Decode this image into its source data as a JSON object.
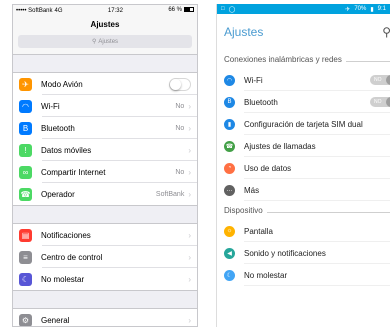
{
  "ios": {
    "status": {
      "carrier": "••••• SoftBank",
      "network": "4G",
      "time": "17:32",
      "battery": "66 %"
    },
    "title": "Ajustes",
    "search_placeholder": "Ajustes",
    "group1": [
      {
        "label": "Modo Avión",
        "value": "",
        "icon": "airplane-icon",
        "color": "#ff9500",
        "toggle": true
      },
      {
        "label": "Wi-Fi",
        "value": "No",
        "icon": "wifi-icon",
        "color": "#007aff"
      },
      {
        "label": "Bluetooth",
        "value": "No",
        "icon": "bluetooth-icon",
        "color": "#007aff"
      },
      {
        "label": "Datos móviles",
        "value": "",
        "icon": "antenna-icon",
        "color": "#4cd964"
      },
      {
        "label": "Compartir Internet",
        "value": "No",
        "icon": "hotspot-icon",
        "color": "#4cd964"
      },
      {
        "label": "Operador",
        "value": "SoftBank",
        "icon": "phone-icon",
        "color": "#4cd964"
      }
    ],
    "group2": [
      {
        "label": "Notificaciones",
        "value": "",
        "icon": "notifications-icon",
        "color": "#ff3b30"
      },
      {
        "label": "Centro de control",
        "value": "",
        "icon": "control-center-icon",
        "color": "#8e8e93"
      },
      {
        "label": "No molestar",
        "value": "",
        "icon": "moon-icon",
        "color": "#5856d6"
      }
    ],
    "group3": [
      {
        "label": "General",
        "value": "",
        "icon": "gear-icon",
        "color": "#8e8e93"
      }
    ]
  },
  "android": {
    "status": {
      "battery": "70%",
      "time": "9:1"
    },
    "title": "Ajustes",
    "section1": "Conexiones inalámbricas y redes",
    "section1_items": [
      {
        "label": "Wi-Fi",
        "toggle": "NO",
        "icon": "wifi-icon",
        "color": "#1e88e5"
      },
      {
        "label": "Bluetooth",
        "toggle": "NO",
        "icon": "bluetooth-icon",
        "color": "#1e88e5"
      },
      {
        "label": "Configuración de tarjeta SIM dual",
        "icon": "sim-card-icon",
        "color": "#1e88e5"
      },
      {
        "label": "Ajustes de llamadas",
        "icon": "phone-icon",
        "color": "#43a047"
      },
      {
        "label": "Uso de datos",
        "icon": "data-usage-icon",
        "color": "#ff7043"
      },
      {
        "label": "Más",
        "icon": "more-icon",
        "color": "#616161"
      }
    ],
    "section2": "Dispositivo",
    "section2_items": [
      {
        "label": "Pantalla",
        "icon": "display-icon",
        "color": "#ffb300"
      },
      {
        "label": "Sonido y notificaciones",
        "icon": "volume-icon",
        "color": "#26a69a"
      },
      {
        "label": "No molestar",
        "icon": "moon-icon",
        "color": "#42a5f5"
      }
    ]
  }
}
